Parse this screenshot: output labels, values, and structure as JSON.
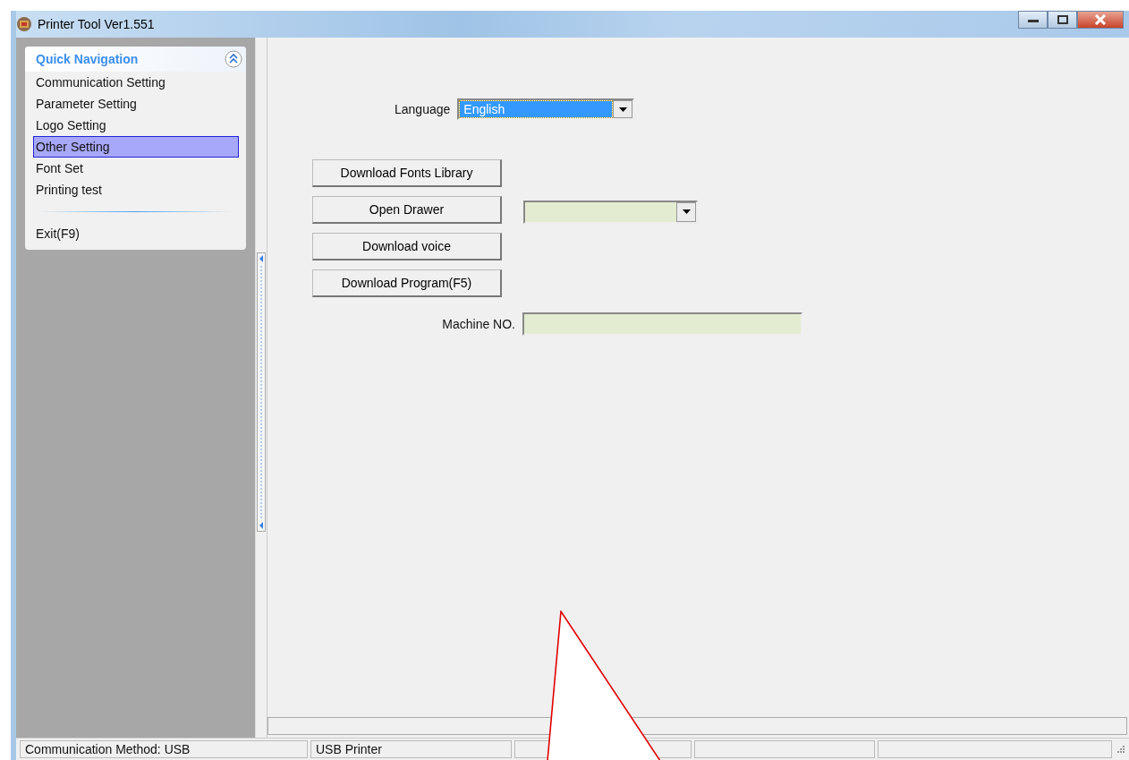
{
  "window": {
    "title": "Printer Tool Ver1.551"
  },
  "sidebar": {
    "title": "Quick Navigation",
    "expanded": true,
    "items": [
      {
        "label": "Communication Setting",
        "selected": false
      },
      {
        "label": "Parameter Setting",
        "selected": false
      },
      {
        "label": "Logo Setting",
        "selected": false
      },
      {
        "label": "Other Setting",
        "selected": true
      },
      {
        "label": "Font Set",
        "selected": false
      },
      {
        "label": "Printing test",
        "selected": false
      }
    ],
    "exit": "Exit(F9)"
  },
  "language": {
    "label": "Language",
    "value": "English"
  },
  "buttons": [
    "Download Fonts Library",
    "Open Drawer",
    "Download voice",
    "Download Program(F5)"
  ],
  "machine": {
    "label": "Machine NO."
  },
  "status_bar": [
    "Communication Method: USB",
    "USB Printer"
  ]
}
